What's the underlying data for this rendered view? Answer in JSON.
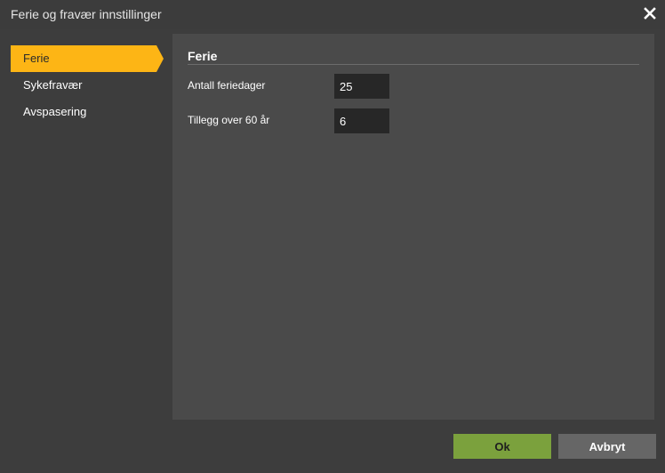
{
  "window": {
    "title": "Ferie og fravær innstillinger",
    "close_icon": "close-icon"
  },
  "sidebar": {
    "items": [
      {
        "label": "Ferie",
        "active": true
      },
      {
        "label": "Sykefravær",
        "active": false
      },
      {
        "label": "Avspasering",
        "active": false
      }
    ]
  },
  "panel": {
    "section_title": "Ferie",
    "fields": [
      {
        "label": "Antall feriedager",
        "value": "25"
      },
      {
        "label": "Tillegg over 60 år",
        "value": "6"
      }
    ]
  },
  "footer": {
    "ok_label": "Ok",
    "cancel_label": "Avbryt"
  },
  "colors": {
    "accent": "#fdb515",
    "ok": "#7ba13d",
    "cancel": "#666666",
    "background": "#3d3d3d",
    "panel": "#4a4a4a"
  }
}
